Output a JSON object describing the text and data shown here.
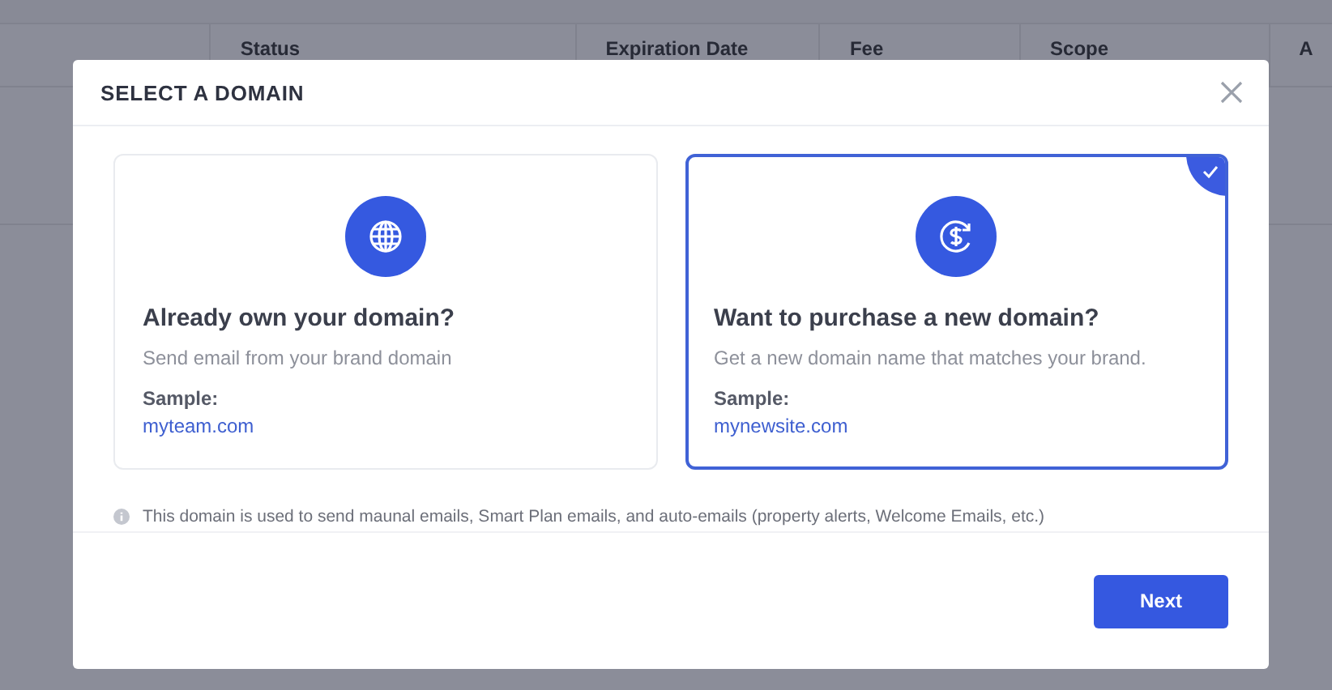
{
  "background_table": {
    "columns": [
      {
        "label": "Status"
      },
      {
        "label": "Expiration Date"
      },
      {
        "label": "Fee"
      },
      {
        "label": "Scope"
      },
      {
        "label": "A"
      }
    ]
  },
  "dialog": {
    "title": "SELECT A DOMAIN",
    "options": [
      {
        "kind": "globe",
        "title": "Already own your domain?",
        "description": "Send email from your brand domain",
        "sample_label": "Sample:",
        "sample": "myteam.com",
        "selected": false
      },
      {
        "kind": "dollar",
        "title": "Want to purchase a new domain?",
        "description": "Get a new domain name that matches your brand.",
        "sample_label": "Sample:",
        "sample": "mynewsite.com",
        "selected": true
      }
    ],
    "note": "This domain is used to send maunal emails, Smart Plan emails, and auto-emails (property alerts, Welcome Emails, etc.)",
    "buttons": [
      {
        "label": "Next"
      }
    ]
  }
}
